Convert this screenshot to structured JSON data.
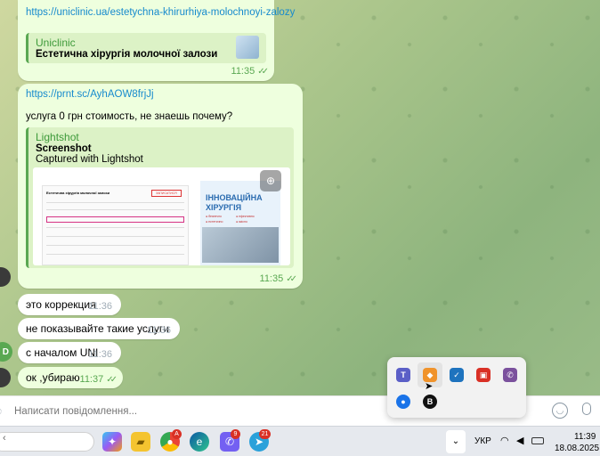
{
  "messages": {
    "m1": {
      "link": "https://uniclinic.ua/estetychna-khirurhiya-molochnoyi-zalozy",
      "preview_site": "Uniclinic",
      "preview_title": "Естетична хірургія молочної залози",
      "time": "11:35"
    },
    "m2": {
      "link": "https://prnt.sc/AyhAOW8frjJj",
      "text": "услуга 0 грн стоимость, не знаешь почему?",
      "preview_site": "Lightshot",
      "preview_title": "Screenshot",
      "preview_desc": "Captured with Lightshot",
      "time": "11:35",
      "screenshot": {
        "heading": "Естетична хірургія молочної залози",
        "button": "ЗАПИСАТИСЯ",
        "promo_title_1": "ІННОВАЦІЙНА",
        "promo_title_2": "ХІРУРГІЯ",
        "promo_tags": [
          "● безпечно",
          "● ефективно",
          "● естетично",
          "● якісно"
        ]
      }
    },
    "incoming": [
      {
        "text": "это коррекция",
        "time": "11:36"
      },
      {
        "text": "не показывайте такие услуги",
        "time": "11:36"
      },
      {
        "text": "с началом UNI",
        "time": "11:36"
      }
    ],
    "m6": {
      "text": "ок ,убираю",
      "time": "11:37"
    }
  },
  "input": {
    "placeholder": "Написати повідомлення..."
  },
  "taskbar": {
    "language": "УКР",
    "time": "11:39",
    "date": "18.08.2025",
    "chrome_badge": "A",
    "viber_badge": "9",
    "telegram_badge": "21"
  },
  "colors": {
    "outgoing_bubble": "#eeffde",
    "accent_green": "#5aa852",
    "link": "#168acd"
  }
}
